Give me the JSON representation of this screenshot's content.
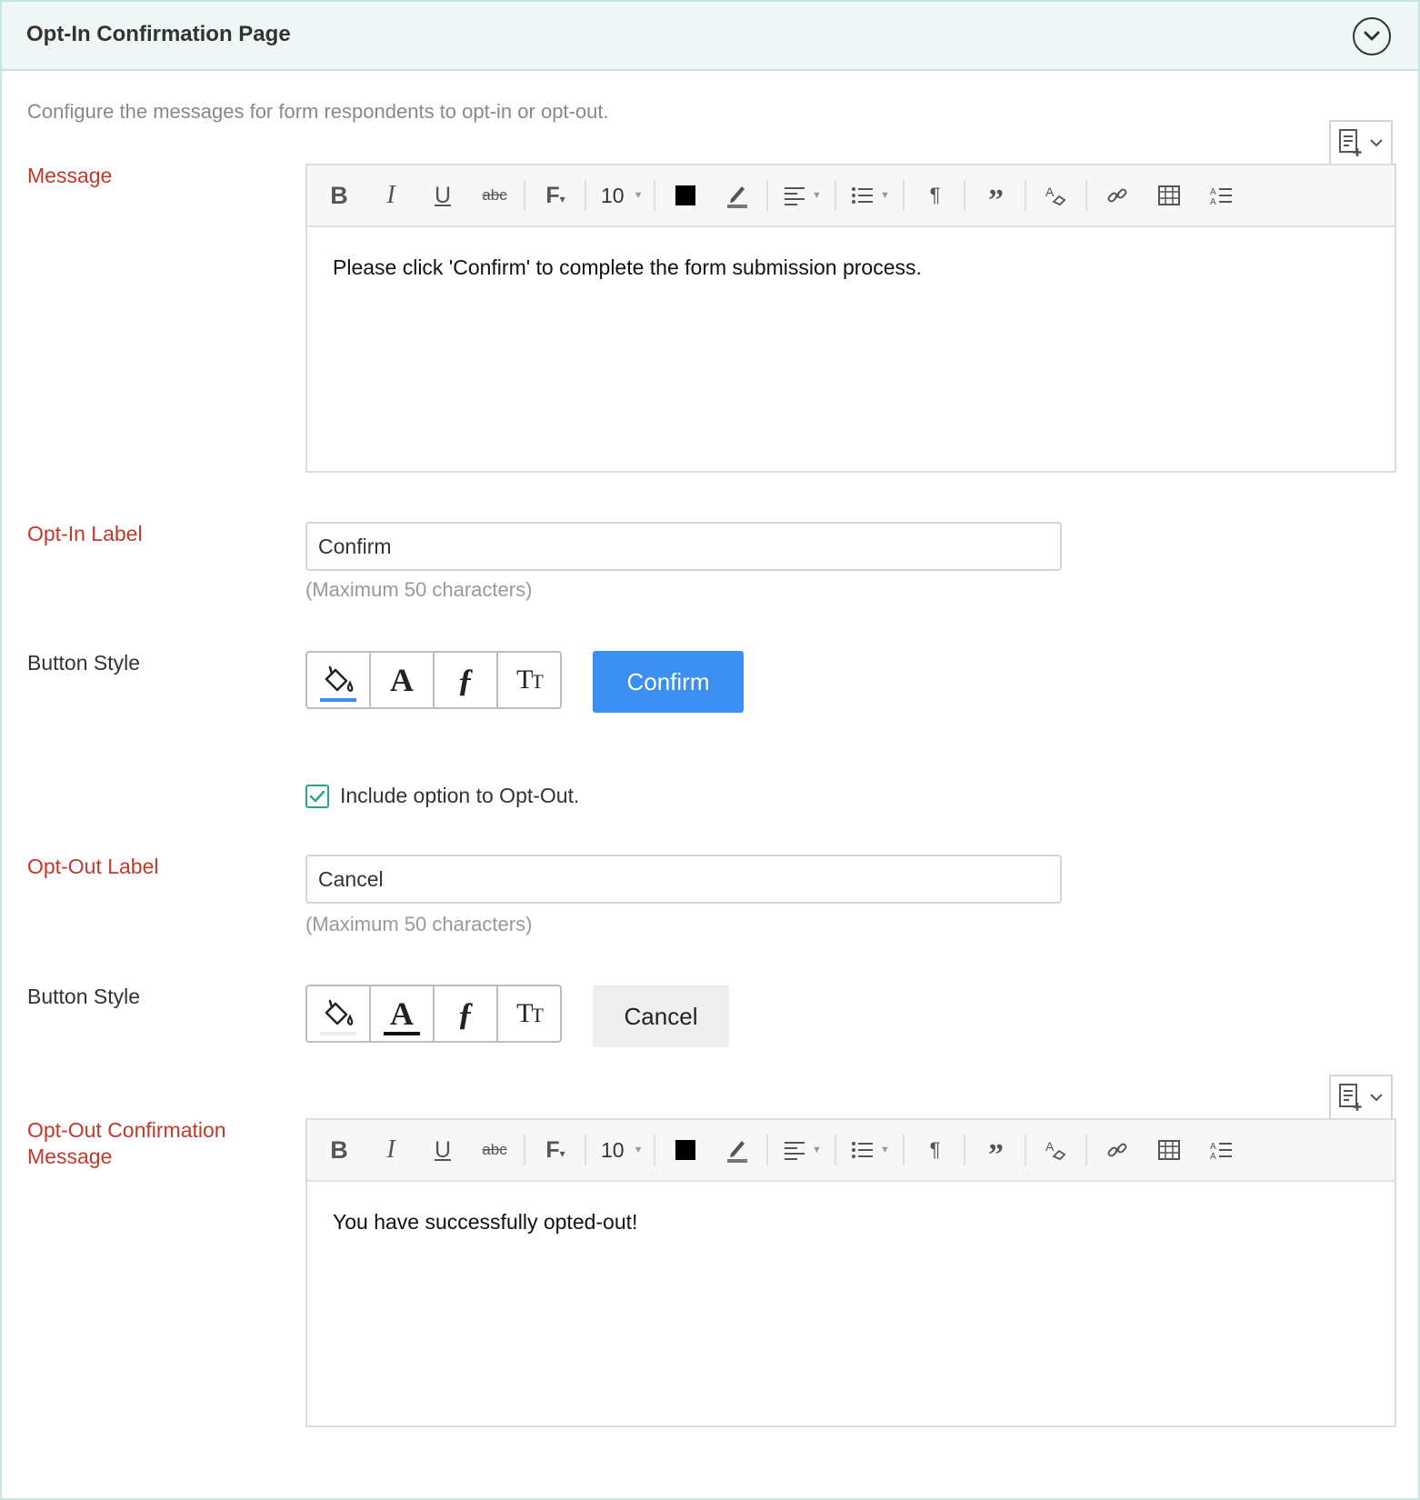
{
  "header": {
    "title": "Opt-In Confirmation Page"
  },
  "description": "Configure the messages for form respondents to opt-in or opt-out.",
  "message": {
    "label": "Message",
    "font_size": "10",
    "content": "Please click 'Confirm' to complete the form submission process."
  },
  "opt_in": {
    "label": "Opt-In Label",
    "value": "Confirm",
    "hint": "(Maximum 50 characters)",
    "button_style_label": "Button Style",
    "preview_label": "Confirm",
    "preview_bg": "#3b8ff0",
    "preview_text_color": "#ffffff",
    "fill_indicator_color": "#3b8ff0"
  },
  "opt_out_option": {
    "label": "Include option to Opt-Out.",
    "checked": true
  },
  "opt_out": {
    "label": "Opt-Out Label",
    "value": "Cancel",
    "hint": "(Maximum 50 characters)",
    "button_style_label": "Button Style",
    "preview_label": "Cancel",
    "preview_bg": "#eeeeee",
    "preview_text_color": "#222222",
    "text_color_indicator": "#111111"
  },
  "opt_out_message": {
    "label_line1": "Opt-Out Confirmation",
    "label_line2": "Message",
    "font_size": "10",
    "content": "You have successfully opted-out!"
  },
  "colors": {
    "accent_label": "#c1392b",
    "header_bg": "#eef7f5",
    "checkbox": "#29a38a"
  },
  "toolbar_icons": [
    "bold-icon",
    "italic-icon",
    "underline-icon",
    "strikethrough-icon",
    "font-family-icon",
    "font-size-dropdown",
    "text-color-icon",
    "highlight-icon",
    "align-icon",
    "list-icon",
    "paragraph-direction-icon",
    "quote-icon",
    "clear-format-icon",
    "link-icon",
    "table-icon",
    "line-height-icon"
  ]
}
